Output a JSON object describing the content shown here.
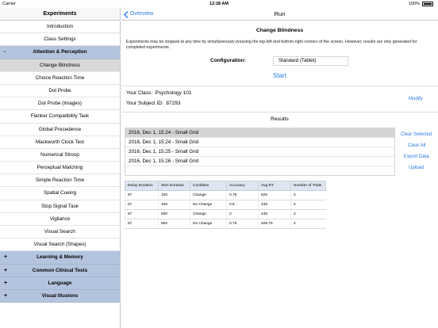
{
  "status_bar": {
    "carrier": "Carrier",
    "time": "12:28 AM",
    "battery": "100%"
  },
  "sidebar": {
    "title": "Experiments",
    "items": [
      {
        "label": "Introduction",
        "type": "item",
        "selected": false
      },
      {
        "label": "Class Settings",
        "type": "item",
        "selected": false
      },
      {
        "label": "Attention & Perception",
        "type": "section",
        "toggle": "-"
      },
      {
        "label": "Change Blindness",
        "type": "item",
        "selected": true
      },
      {
        "label": "Choice Reaction Time",
        "type": "item",
        "selected": false
      },
      {
        "label": "Dot Probe",
        "type": "item",
        "selected": false
      },
      {
        "label": "Dot Probe (Images)",
        "type": "item",
        "selected": false
      },
      {
        "label": "Flanker Compatibility Task",
        "type": "item",
        "selected": false
      },
      {
        "label": "Global Precedence",
        "type": "item",
        "selected": false
      },
      {
        "label": "Mackworth Clock Test",
        "type": "item",
        "selected": false
      },
      {
        "label": "Numerical Stroop",
        "type": "item",
        "selected": false
      },
      {
        "label": "Perceptual Matching",
        "type": "item",
        "selected": false
      },
      {
        "label": "Simple Reaction Time",
        "type": "item",
        "selected": false
      },
      {
        "label": "Spatial Cueing",
        "type": "item",
        "selected": false
      },
      {
        "label": "Stop Signal Task",
        "type": "item",
        "selected": false
      },
      {
        "label": "Vigilance",
        "type": "item",
        "selected": false
      },
      {
        "label": "Visual Search",
        "type": "item",
        "selected": false
      },
      {
        "label": "Visual Search (Shapes)",
        "type": "item",
        "selected": false
      },
      {
        "label": "Learning & Memory",
        "type": "section",
        "toggle": "+"
      },
      {
        "label": "Common Clinical Tests",
        "type": "section",
        "toggle": "+"
      },
      {
        "label": "Language",
        "type": "section",
        "toggle": "+"
      },
      {
        "label": "Visual Illusions",
        "type": "section",
        "toggle": "+"
      }
    ]
  },
  "navbar": {
    "back_label": "Overview",
    "title": "Run"
  },
  "experiment": {
    "title": "Change Blindness",
    "note": "Experiments may be stopped at any time by simultaneously pressing the top-left and bottom-right corners of the screen. However, results are only generated for completed experiments.",
    "config_label": "Configuration:",
    "config_value": "Standard (Tablet)",
    "start_label": "Start"
  },
  "subject": {
    "class_label": "Your Class:",
    "class_value": "Psychology 101",
    "id_label": "Your Subject ID:",
    "id_value": "87293",
    "modify_label": "Modify"
  },
  "results": {
    "title": "Results",
    "rows": [
      {
        "label": "2016, Dec  1, 15:24 - Small Grid",
        "selected": true
      },
      {
        "label": "2016, Dec  1, 15:24 - Small Grid",
        "selected": false
      },
      {
        "label": "2016, Dec  1, 15:25 - Small Grid",
        "selected": false
      },
      {
        "label": "2016, Dec  1, 15:26 - Small Grid",
        "selected": false
      }
    ],
    "actions": {
      "clear_selected": "Clear Selected",
      "clear_all": "Clear All",
      "export_data": "Export Data",
      "upload": "Upload"
    }
  },
  "table": {
    "headers": [
      "Delay Duration",
      "Stim Duration",
      "Condition",
      "Accuracy",
      "Avg RT",
      "Number of Trials"
    ],
    "rows": [
      [
        "67",
        "100",
        "Change",
        "0.75",
        "525",
        "4"
      ],
      [
        "67",
        "100",
        "No Change",
        "0.5",
        "435",
        "4"
      ],
      [
        "67",
        "500",
        "Change",
        "0",
        "446",
        "4"
      ],
      [
        "67",
        "500",
        "No Change",
        "0.75",
        "408.75",
        "4"
      ]
    ]
  },
  "colors": {
    "accent": "#2a7ae2",
    "section_bg": "#b5c4de",
    "selected_bg": "#d9d9d9"
  }
}
